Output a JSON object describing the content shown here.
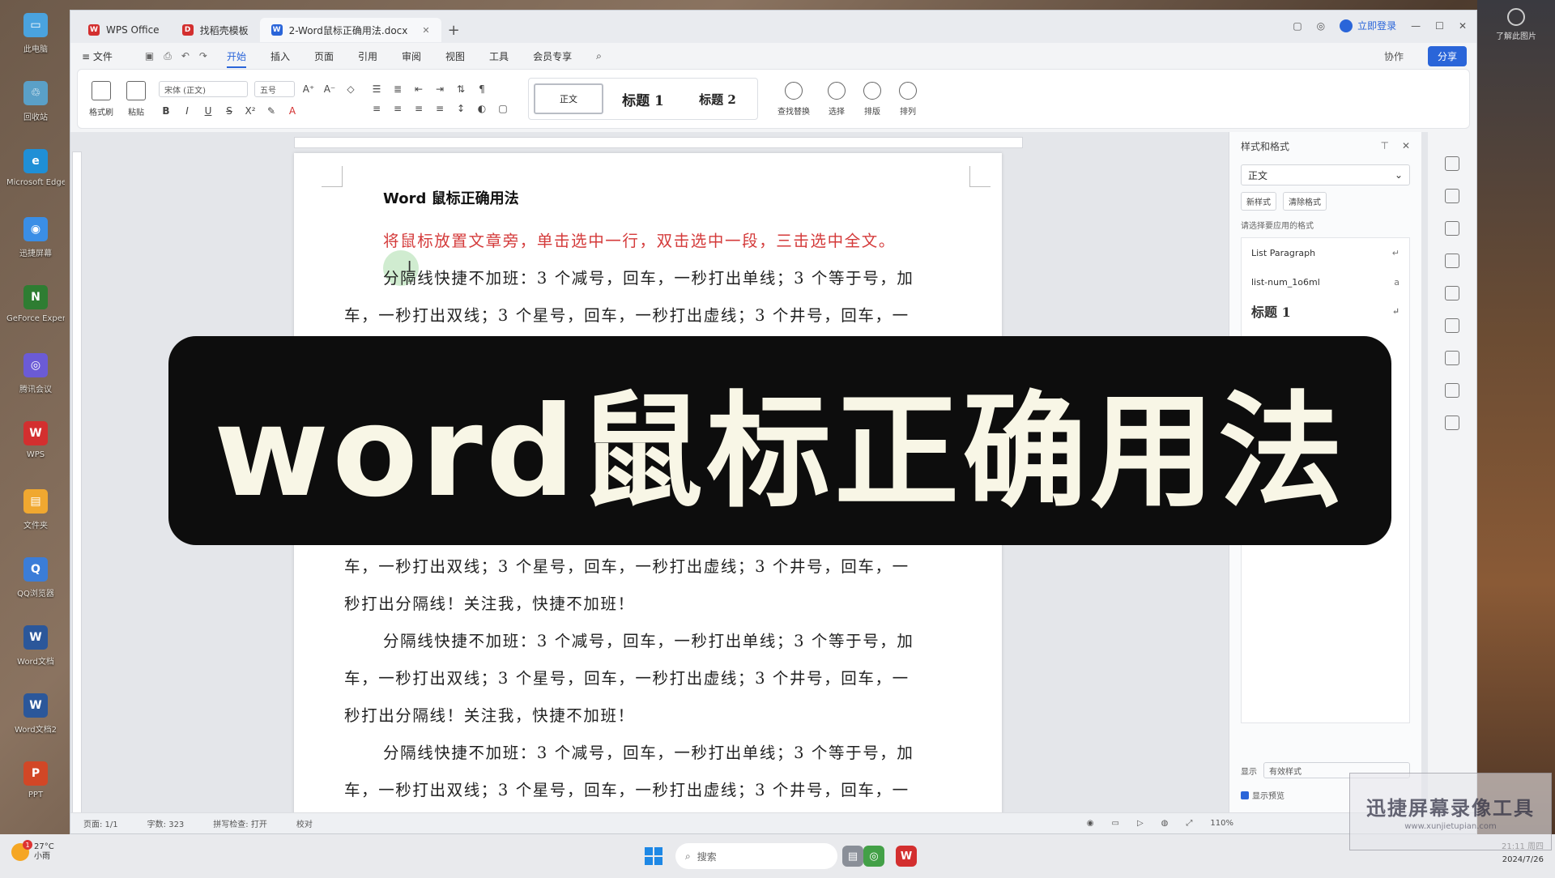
{
  "desktop": {
    "icons": [
      {
        "label": "此电脑",
        "color": "#4aa3df",
        "glyph": "▭"
      },
      {
        "label": "回收站",
        "color": "#5aa0c8",
        "glyph": "♲"
      },
      {
        "label": "Microsoft Edge",
        "color": "#1f8fd6",
        "glyph": "e"
      },
      {
        "label": "迅捷屏幕",
        "color": "#3a8ee6",
        "glyph": "◉"
      },
      {
        "label": "GeForce Experience",
        "color": "#2e7d32",
        "glyph": "N"
      },
      {
        "label": "腾讯会议",
        "color": "#6b5bd6",
        "glyph": "◎"
      },
      {
        "label": "WPS",
        "color": "#d32f2f",
        "glyph": "W"
      },
      {
        "label": "文件夹",
        "color": "#f0a830",
        "glyph": "▤"
      },
      {
        "label": "QQ浏览器",
        "color": "#3b7dd8",
        "glyph": "Q"
      },
      {
        "label": "Word文档",
        "color": "#2b579a",
        "glyph": "W"
      },
      {
        "label": "Word文档2",
        "color": "#2b579a",
        "glyph": "W"
      },
      {
        "label": "PPT",
        "color": "#d24726",
        "glyph": "P"
      }
    ],
    "top_right_widget": "了解此图片"
  },
  "window": {
    "tabs": [
      {
        "label": "WPS Office",
        "color": "#d32f2f",
        "glyph": "W"
      },
      {
        "label": "找稻壳模板",
        "color": "#d32f2f",
        "glyph": "D"
      },
      {
        "label": "2-Word鼠标正确用法.docx",
        "color": "#2a65d9",
        "glyph": "W"
      }
    ],
    "login_label": "立即登录",
    "menu": {
      "file": "≡ 文件",
      "items": [
        "开始",
        "插入",
        "页面",
        "引用",
        "审阅",
        "视图",
        "工具",
        "会员专享"
      ],
      "active": "开始",
      "collab": "协作",
      "share": "分享"
    },
    "ribbon": {
      "format_painter": "格式刷",
      "paste": "粘贴",
      "font_name": "宋体 (正文)",
      "font_size": "五号",
      "styles": {
        "normal": "正文",
        "h1": "标题 1",
        "h2": "标题 2"
      },
      "find_replace": "查找替换",
      "select": "选择",
      "layout": "排版",
      "arrange": "排列"
    },
    "document": {
      "title_prefix": "Word",
      "title_cn": " 鼠标正确用法",
      "red_line": "将鼠标放置文章旁，单击选中一行，双击选中一段，三击选中全文。",
      "para_a": "分隔线快捷不加班：3 个减号，回车，一秒打出单线；3 个等于号，加",
      "para_b": "车，一秒打出双线；3 个星号，回车，一秒打出虚线；3 个井号，回车，一",
      "para_c": "秒打出分隔线！关注我，快捷不加班！"
    },
    "side_panel": {
      "title": "样式和格式",
      "current_style": "正文",
      "new_style": "新样式",
      "clear_format": "清除格式",
      "hint": "请选择要应用的格式",
      "items": [
        "List Paragraph",
        "list-num_1o6ml",
        "标题 1"
      ],
      "show_label": "显示",
      "show_value": "有效样式",
      "preview_label": "显示预览"
    },
    "statusbar": {
      "page": "页面: 1/1",
      "words": "字数: 323",
      "spell": "拼写检查: 打开",
      "proof": "校对",
      "zoom": "110%"
    }
  },
  "banner": {
    "text": "word鼠标正确用法"
  },
  "watermark": {
    "text": "迅捷屏幕录像工具",
    "sub": "www.xunjietupian.com"
  },
  "taskbar": {
    "weather_temp": "27°C",
    "weather_desc": "小雨",
    "weather_badge": "1",
    "search": "搜索",
    "time": "21:11 周四",
    "date": "2024/7/26"
  }
}
